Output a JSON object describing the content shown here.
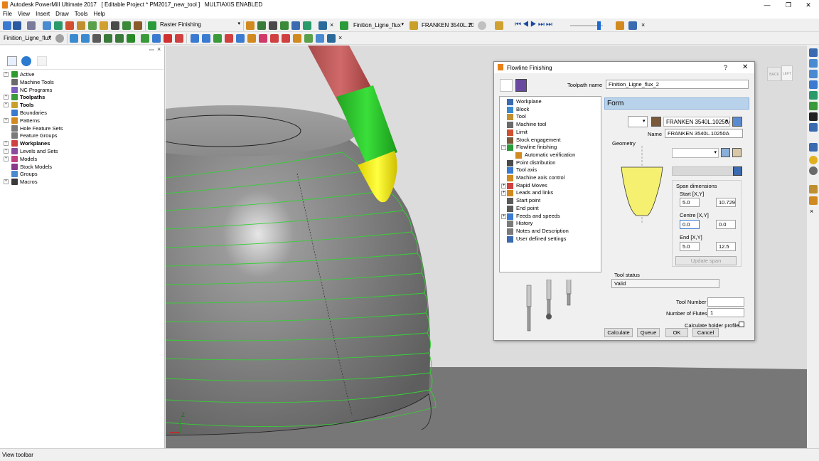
{
  "window": {
    "title": "Autodesk PowerMill Ultimate 2017   [ Editable Project * PM2017_new_tool ]   MULTIAXIS ENABLED",
    "controls": [
      "—",
      "❐",
      "✕"
    ]
  },
  "menu": [
    "File",
    "View",
    "Insert",
    "Draw",
    "Tools",
    "Help"
  ],
  "toolbar1": {
    "strategy_label": "Raster Finishing",
    "toolpath_combo": "Finition_Ligne_flux",
    "tool_combo": "FRANKEN 3540L.10",
    "close_x": "×"
  },
  "toolbar2": {
    "toolpath_combo": "Finition_Ligne_flux",
    "close_x": "×"
  },
  "explorer": {
    "pin": "ꟷ",
    "close": "×",
    "items": [
      {
        "label": "Active",
        "bold": false,
        "expander": "+",
        "color": "#2e9b2e"
      },
      {
        "label": "Machine Tools",
        "bold": false,
        "expander": "",
        "color": "#6a6a6a"
      },
      {
        "label": "NC Programs",
        "bold": false,
        "expander": "",
        "color": "#7a5fc0"
      },
      {
        "label": "Toolpaths",
        "bold": true,
        "expander": "+",
        "color": "#3a9c3a"
      },
      {
        "label": "Tools",
        "bold": true,
        "expander": "+",
        "color": "#c8a02a"
      },
      {
        "label": "Boundaries",
        "bold": false,
        "expander": "",
        "color": "#3a7ad0"
      },
      {
        "label": "Patterns",
        "bold": false,
        "expander": "+",
        "color": "#d08a20"
      },
      {
        "label": "Hole Feature Sets",
        "bold": false,
        "expander": "",
        "color": "#7a7a7a"
      },
      {
        "label": "Feature Groups",
        "bold": false,
        "expander": "",
        "color": "#7a7a7a"
      },
      {
        "label": "Workplanes",
        "bold": true,
        "expander": "+",
        "color": "#d04040"
      },
      {
        "label": "Levels and Sets",
        "bold": false,
        "expander": "+",
        "color": "#8a4aa0"
      },
      {
        "label": "Models",
        "bold": false,
        "expander": "+",
        "color": "#c04080"
      },
      {
        "label": "Stock Models",
        "bold": false,
        "expander": "",
        "color": "#8a3a8a"
      },
      {
        "label": "Groups",
        "bold": false,
        "expander": "",
        "color": "#4a8ad0"
      },
      {
        "label": "Macros",
        "bold": false,
        "expander": "+",
        "color": "#3a3a3a"
      }
    ]
  },
  "viewcube": {
    "back": "BACK",
    "left": "LEFT"
  },
  "axis": {
    "z": "Z"
  },
  "status": {
    "text": "View toolbar"
  },
  "dialog": {
    "title": "Flowline Finishing",
    "help": "?",
    "close": "✕",
    "toolpath_name_label": "Toolpath name",
    "toolpath_name": "Finition_Ligne_flux_2",
    "tree": [
      {
        "label": "Workplane",
        "indent": 0,
        "expander": ""
      },
      {
        "label": "Block",
        "indent": 0,
        "expander": ""
      },
      {
        "label": "Tool",
        "indent": 0,
        "expander": ""
      },
      {
        "label": "Machine tool",
        "indent": 0,
        "expander": ""
      },
      {
        "label": "Limit",
        "indent": 0,
        "expander": ""
      },
      {
        "label": "Stock engagement",
        "indent": 0,
        "expander": ""
      },
      {
        "label": "Flowline finishing",
        "indent": 0,
        "expander": "−"
      },
      {
        "label": "Automatic verification",
        "indent": 1,
        "expander": ""
      },
      {
        "label": "Point distribution",
        "indent": 0,
        "expander": ""
      },
      {
        "label": "Tool axis",
        "indent": 0,
        "expander": ""
      },
      {
        "label": "Machine axis control",
        "indent": 0,
        "expander": ""
      },
      {
        "label": "Rapid Moves",
        "indent": 0,
        "expander": "+"
      },
      {
        "label": "Leads and links",
        "indent": 0,
        "expander": "+"
      },
      {
        "label": "Start point",
        "indent": 0,
        "expander": ""
      },
      {
        "label": "End point",
        "indent": 0,
        "expander": ""
      },
      {
        "label": "Feeds and speeds",
        "indent": 0,
        "expander": "+"
      },
      {
        "label": "History",
        "indent": 0,
        "expander": ""
      },
      {
        "label": "Notes and Description",
        "indent": 0,
        "expander": ""
      },
      {
        "label": "User defined settings",
        "indent": 0,
        "expander": ""
      }
    ],
    "form": {
      "header": "Form",
      "tool_combo": "FRANKEN 3540L.10250A",
      "name_label": "Name",
      "name_value": "FRANKEN 3540L.10250A",
      "geometry_label": "Geometry",
      "span_dimensions": "Span dimensions",
      "start_label": "Start [X,Y]",
      "start_x": "5.0",
      "start_y": "10.7295",
      "centre_label": "Centre [X,Y]",
      "centre_x": "0.0",
      "centre_y": "0.0",
      "end_label": "End [X,Y]",
      "end_x": "5.0",
      "end_y": "12.5",
      "update_span": "Update span",
      "tool_status_label": "Tool status",
      "tool_status": "Valid",
      "tool_number_label": "Tool Number",
      "tool_number": "",
      "flutes_label": "Number of Flutes",
      "flutes": "1",
      "holder_label": "Calculate holder profile"
    },
    "buttons": {
      "calculate": "Calculate",
      "queue": "Queue",
      "ok": "OK",
      "cancel": "Cancel"
    }
  }
}
